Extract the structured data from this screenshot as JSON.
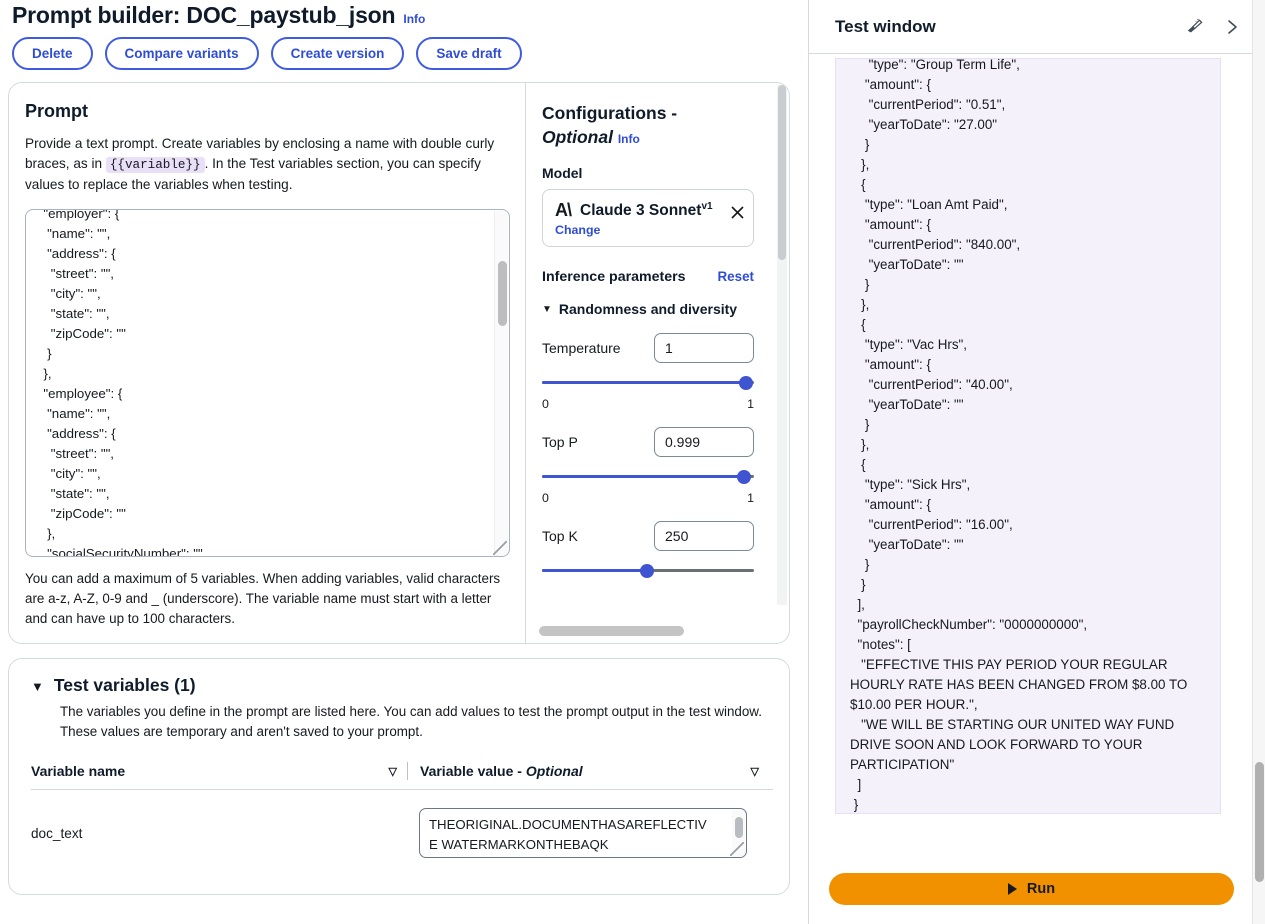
{
  "header": {
    "title": "Prompt builder: DOC_paystub_json",
    "info_label": "Info",
    "buttons": [
      {
        "label": "Delete",
        "name": "delete-button"
      },
      {
        "label": "Compare variants",
        "name": "compare-variants-button"
      },
      {
        "label": "Create version",
        "name": "create-version-button"
      },
      {
        "label": "Save draft",
        "name": "save-draft-button"
      }
    ]
  },
  "prompt": {
    "heading": "Prompt",
    "description_part1": "Provide a text prompt. Create variables by enclosing a name with double curly braces, as in",
    "variable_chip": "{{variable}}",
    "description_part2": ". In the Test variables section, you can specify values to replace the variables when testing.",
    "textarea_value": "  \"employer\": {\n   \"name\": \"\",\n   \"address\": {\n    \"street\": \"\",\n    \"city\": \"\",\n    \"state\": \"\",\n    \"zipCode\": \"\"\n   }\n  },\n  \"employee\": {\n   \"name\": \"\",\n   \"address\": {\n    \"street\": \"\",\n    \"city\": \"\",\n    \"state\": \"\",\n    \"zipCode\": \"\"\n   },\n   \"socialSecurityNumber\": \"\",",
    "hint": "You can add a maximum of 5 variables. When adding variables, valid characters are a-z, A-Z, 0-9 and _ (underscore). The variable name must start with a letter and can have up to 100 characters."
  },
  "configurations": {
    "title_line1": "Configurations -",
    "title_line2": "Optional",
    "info_label": "Info",
    "model_label": "Model",
    "model": {
      "logo": "anthropic-logo",
      "name": "Claude 3 Sonnet",
      "version": "v1",
      "change_label": "Change"
    },
    "inference_parameters_label": "Inference parameters",
    "reset_label": "Reset",
    "accordion_label": "Randomness and diversity",
    "params": [
      {
        "name": "Temperature",
        "value": "1",
        "min": "0",
        "max": "1",
        "fill_pct": 97
      },
      {
        "name": "Top P",
        "value": "0.999",
        "min": "0",
        "max": "1",
        "fill_pct": 96
      },
      {
        "name": "Top K",
        "value": "250",
        "min": "",
        "max": "",
        "fill_pct": 50
      }
    ]
  },
  "test_variables": {
    "title": "Test variables (1)",
    "description": "The variables you define in the prompt are listed here. You can add values to test the prompt output in the test window. These values are temporary and aren't saved to your prompt.",
    "columns": {
      "name": "Variable name",
      "value": "Variable value - ",
      "value_optional": "Optional"
    },
    "rows": [
      {
        "name": "doc_text",
        "value": "THEORIGINAL.DOCUMENTHASAREFLECTIVE WATERMARKONTHEBAQK"
      }
    ]
  },
  "test_window": {
    "title": "Test window",
    "clear_icon": "broom-icon",
    "collapse_icon": "chevron-right-icon",
    "output": "     \"type\": \"Group Term Life\",\n    \"amount\": {\n     \"currentPeriod\": \"0.51\",\n     \"yearToDate\": \"27.00\"\n    }\n   },\n   {\n    \"type\": \"Loan Amt Paid\",\n    \"amount\": {\n     \"currentPeriod\": \"840.00\",\n     \"yearToDate\": \"\"\n    }\n   },\n   {\n    \"type\": \"Vac Hrs\",\n    \"amount\": {\n     \"currentPeriod\": \"40.00\",\n     \"yearToDate\": \"\"\n    }\n   },\n   {\n    \"type\": \"Sick Hrs\",\n    \"amount\": {\n     \"currentPeriod\": \"16.00\",\n     \"yearToDate\": \"\"\n    }\n   }\n  ],\n  \"payrollCheckNumber\": \"0000000000\",\n  \"notes\": [\n   \"EFFECTIVE THIS PAY PERIOD YOUR REGULAR HOURLY RATE HAS BEEN CHANGED FROM $8.00 TO $10.00 PER HOUR.\",\n   \"WE WILL BE STARTING OUR UNITED WAY FUND DRIVE SOON AND LOOK FORWARD TO YOUR PARTICIPATION\"\n  ]\n }",
    "run_label": "Run"
  },
  "colors": {
    "accent_blue": "#2f4dd4",
    "run_orange": "#f29100",
    "output_bg": "#f5f1fb",
    "chip_purple": "#e9e0f7"
  }
}
